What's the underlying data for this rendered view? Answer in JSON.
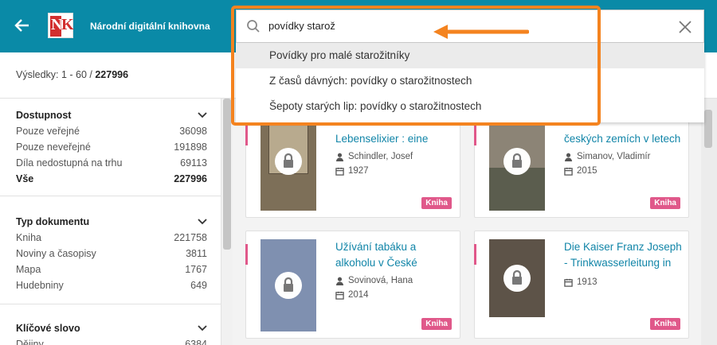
{
  "header": {
    "brand": "Národní digitální knihovna",
    "logo_n": "N",
    "logo_k": "K"
  },
  "results": {
    "prefix": "Výsledky: 1 - 60 / ",
    "total": "227996"
  },
  "facets": [
    {
      "title": "Dostupnost",
      "rows": [
        {
          "label": "Pouze veřejné",
          "count": "36098"
        },
        {
          "label": "Pouze neveřejné",
          "count": "191898"
        },
        {
          "label": "Díla nedostupná na trhu",
          "count": "69113"
        },
        {
          "label": "Vše",
          "count": "227996"
        }
      ]
    },
    {
      "title": "Typ dokumentu",
      "rows": [
        {
          "label": "Kniha",
          "count": "221758"
        },
        {
          "label": "Noviny a časopisy",
          "count": "3811"
        },
        {
          "label": "Mapa",
          "count": "1767"
        },
        {
          "label": "Hudebniny",
          "count": "649"
        }
      ]
    },
    {
      "title": "Klíčové slovo",
      "rows": [
        {
          "label": "Dějiny",
          "count": "6384"
        }
      ]
    }
  ],
  "search": {
    "value": "povídky starož"
  },
  "suggestions": [
    "Povídky pro malé starožitníky",
    "Z časů dávných: povídky o starožitnostech",
    "Šepoty starých lip: povídky o starožitnostech"
  ],
  "cards": [
    {
      "title": "Lebenselixier : eine",
      "author": "Schindler, Josef",
      "year": "1927",
      "badge": "Kniha"
    },
    {
      "title": "českých zemích v letech",
      "author": "Simanov, Vladimír",
      "year": "2015",
      "badge": "Kniha"
    },
    {
      "title": "Užívání tabáku a alkoholu v České",
      "author": "Sovinová, Hana",
      "year": "2014",
      "badge": "Kniha"
    },
    {
      "title": "Die Kaiser Franz Joseph - Trinkwasserleitung in",
      "author": "",
      "year": "1913",
      "badge": "Kniha"
    }
  ],
  "colors": {
    "header": "#0a8aa7",
    "accent": "#e0588a",
    "highlight": "#f4831f",
    "link": "#1185a8"
  }
}
